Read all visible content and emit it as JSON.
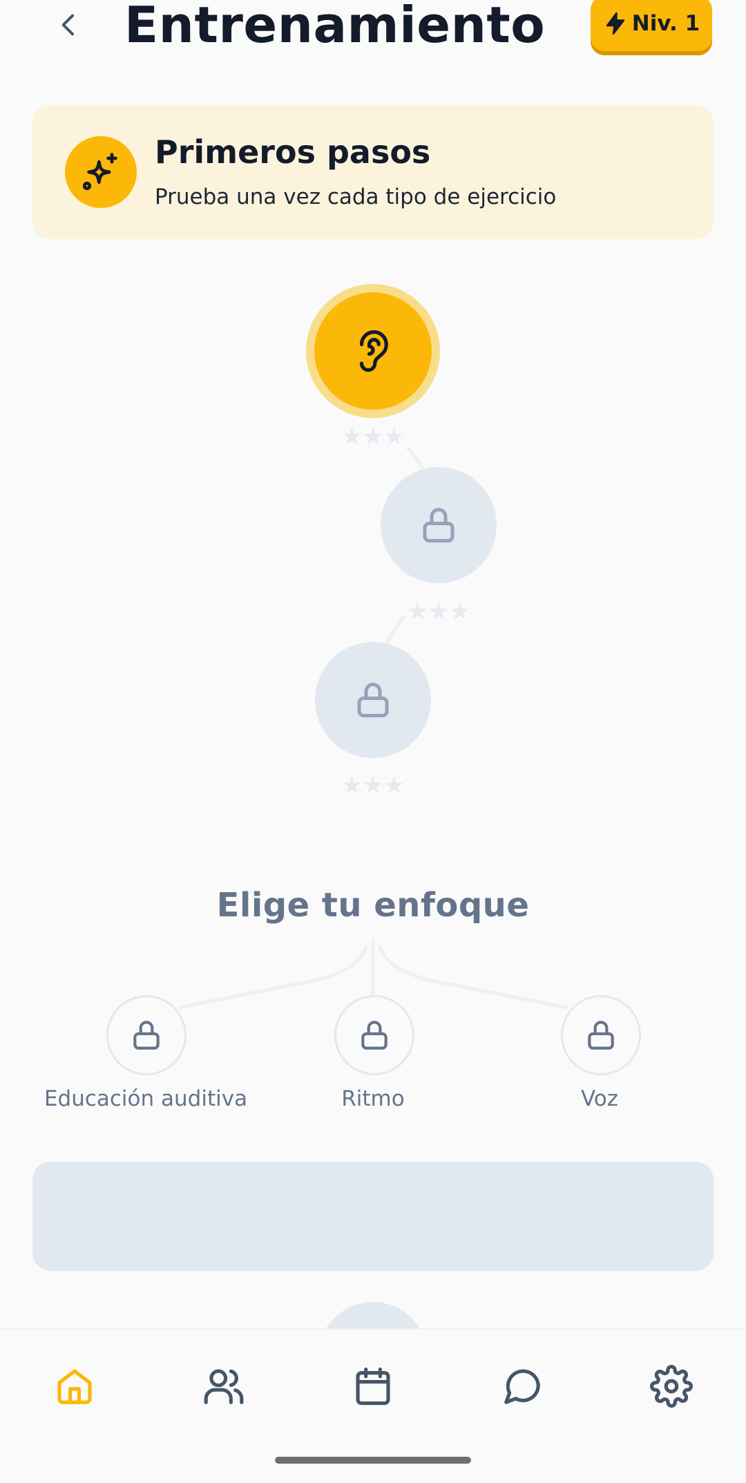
{
  "header": {
    "title": "Entrenamiento",
    "level_label": "Niv. 1"
  },
  "goal_card": {
    "title": "Primeros pasos",
    "subtitle": "Prueba una vez cada tipo de ejercicio"
  },
  "path": {
    "nodes": [
      {
        "state": "active",
        "icon": "ear-icon",
        "stars_earned": 0,
        "stars_total": 3
      },
      {
        "state": "locked",
        "icon": "lock-icon",
        "stars_earned": 0,
        "stars_total": 3
      },
      {
        "state": "locked",
        "icon": "lock-icon",
        "stars_earned": 0,
        "stars_total": 3
      }
    ]
  },
  "focus": {
    "title": "Elige tu enfoque",
    "options": [
      {
        "label": "Educación auditiva",
        "icon": "lock-icon"
      },
      {
        "label": "Ritmo",
        "icon": "lock-icon"
      },
      {
        "label": "Voz",
        "icon": "lock-icon"
      }
    ]
  },
  "stars": {
    "glyph": "★★★"
  },
  "nav": {
    "items": [
      {
        "icon": "home-icon",
        "active": true
      },
      {
        "icon": "users-icon",
        "active": false
      },
      {
        "icon": "calendar-icon",
        "active": false
      },
      {
        "icon": "chat-icon",
        "active": false
      },
      {
        "icon": "gear-icon",
        "active": false
      }
    ]
  },
  "colors": {
    "accent": "#FBB808",
    "accent_light": "#FCF3DC",
    "locked": "#E2E8F0",
    "muted_text": "#64748B",
    "title_text": "#141B2A"
  }
}
